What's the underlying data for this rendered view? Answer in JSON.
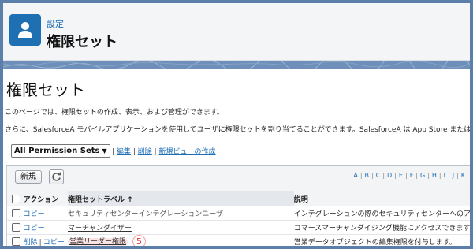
{
  "header": {
    "breadcrumb": "設定",
    "title": "権限セット"
  },
  "page": {
    "title": "権限セット",
    "desc1": "このページでは、権限セットの作成、表示、および管理ができます。",
    "desc2": "さらに、SalesforceA モバイルアプリケーションを使用してユーザに権限セットを割り当てることができます。SalesforceA は App Store または Google P"
  },
  "view": {
    "selected": "All Permission Sets",
    "edit": "編集",
    "delete": "削除",
    "new_view": "新規ビューの作成",
    "sep": "|"
  },
  "toolbar": {
    "new_label": "新規"
  },
  "alphabet": [
    "A",
    "B",
    "C",
    "D",
    "E",
    "F",
    "G",
    "H",
    "I",
    "J",
    "K"
  ],
  "table": {
    "headers": {
      "action": "アクション",
      "label": "権限セットラベル ↑",
      "description": "説明"
    },
    "rows": [
      {
        "action1": "コピー",
        "action2": "",
        "label": "セキュリティセンターインテグレーションユーザ",
        "description": "インテグレーションの際のセキュリティセンターへのア"
      },
      {
        "action1": "コピー",
        "action2": "",
        "label": "マーチャンダイザー",
        "description": "コマースマーチャンダイジング機能にアクセスできます"
      },
      {
        "action1": "削除",
        "action2": "コピー",
        "label": "営業リーダー権限",
        "description": "営業データオブジェクトの編集権限を付与します。",
        "marker": "5"
      }
    ]
  }
}
